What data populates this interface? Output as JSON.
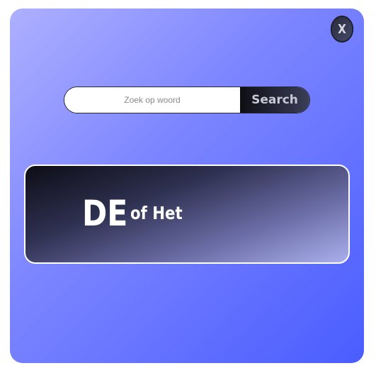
{
  "dialog": {
    "close_label": "X"
  },
  "search": {
    "placeholder": "Zoek op woord",
    "value": "",
    "button_label": "Search"
  },
  "result": {
    "article": "DE",
    "hint": "of Het"
  },
  "colors": {
    "background_gradient_start": "#aeb0ff",
    "background_gradient_end": "#4a5dff",
    "button_dark": "#0e0e14",
    "text_light": "#ffffff"
  }
}
